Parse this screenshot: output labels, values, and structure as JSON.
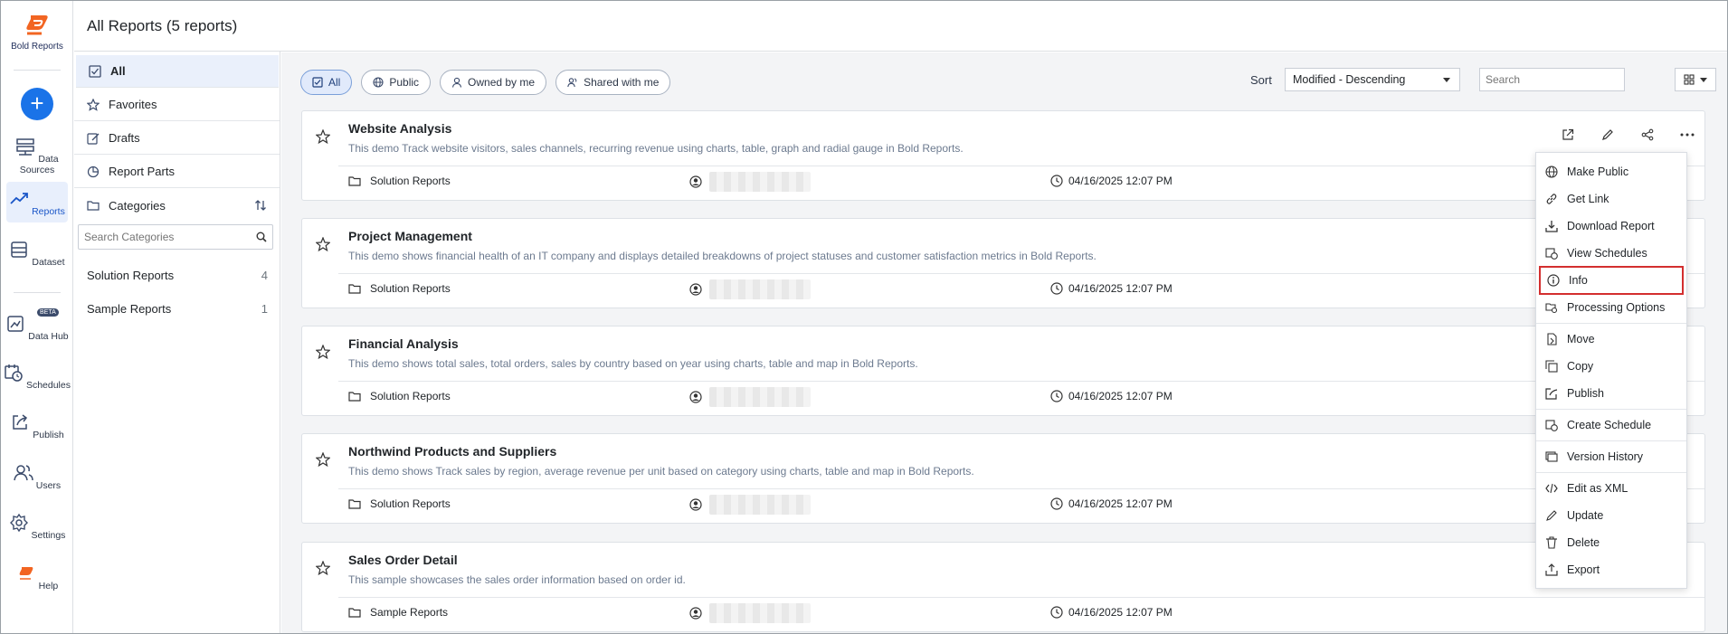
{
  "app": {
    "brand": "Bold Reports",
    "accent": "#1a73e8",
    "logo_color": "#f26522"
  },
  "rail": {
    "data_sources": "Data Sources",
    "reports": "Reports",
    "dataset": "Dataset",
    "data_hub": "Data Hub",
    "beta": "BETA",
    "schedules": "Schedules",
    "publish": "Publish",
    "users": "Users",
    "settings": "Settings",
    "help": "Help"
  },
  "header": {
    "title": "All Reports (5 reports)"
  },
  "categories_panel": {
    "items": [
      "All",
      "Favorites",
      "Drafts",
      "Report Parts",
      "Categories"
    ],
    "search_placeholder": "Search Categories",
    "categories": [
      {
        "name": "Solution Reports",
        "count": "4"
      },
      {
        "name": "Sample Reports",
        "count": "1"
      }
    ]
  },
  "filters": {
    "all": "All",
    "public": "Public",
    "owned": "Owned by me",
    "shared": "Shared with me"
  },
  "sort": {
    "label": "Sort",
    "value": "Modified - Descending"
  },
  "search": {
    "placeholder": "Search"
  },
  "reports": [
    {
      "title": "Website Analysis",
      "description": "This demo Track website visitors, sales channels, recurring revenue using charts, table, graph and radial gauge in Bold Reports.",
      "category": "Solution Reports",
      "modified": "04/16/2025 12:07 PM"
    },
    {
      "title": "Project Management",
      "description": "This demo shows financial health of an IT company and displays detailed breakdowns of project statuses and customer satisfaction metrics in Bold Reports.",
      "category": "Solution Reports",
      "modified": "04/16/2025 12:07 PM"
    },
    {
      "title": "Financial Analysis",
      "description": "This demo shows total sales, total orders, sales by country based on year using charts, table and map in Bold Reports.",
      "category": "Solution Reports",
      "modified": "04/16/2025 12:07 PM"
    },
    {
      "title": "Northwind Products and Suppliers",
      "description": "This demo shows Track sales by region, average revenue per unit based on category using charts, table and map in Bold Reports.",
      "category": "Solution Reports",
      "modified": "04/16/2025 12:07 PM"
    },
    {
      "title": "Sales Order Detail",
      "description": "This sample showcases the sales order information based on order id.",
      "category": "Sample Reports",
      "modified": "04/16/2025 12:07 PM"
    }
  ],
  "context_menu": {
    "make_public": "Make Public",
    "get_link": "Get Link",
    "download": "Download Report",
    "view_schedules": "View Schedules",
    "info": "Info",
    "processing": "Processing Options",
    "move": "Move",
    "copy": "Copy",
    "publish": "Publish",
    "create_schedule": "Create Schedule",
    "version_history": "Version History",
    "edit_xml": "Edit as XML",
    "update": "Update",
    "delete": "Delete",
    "export": "Export"
  }
}
